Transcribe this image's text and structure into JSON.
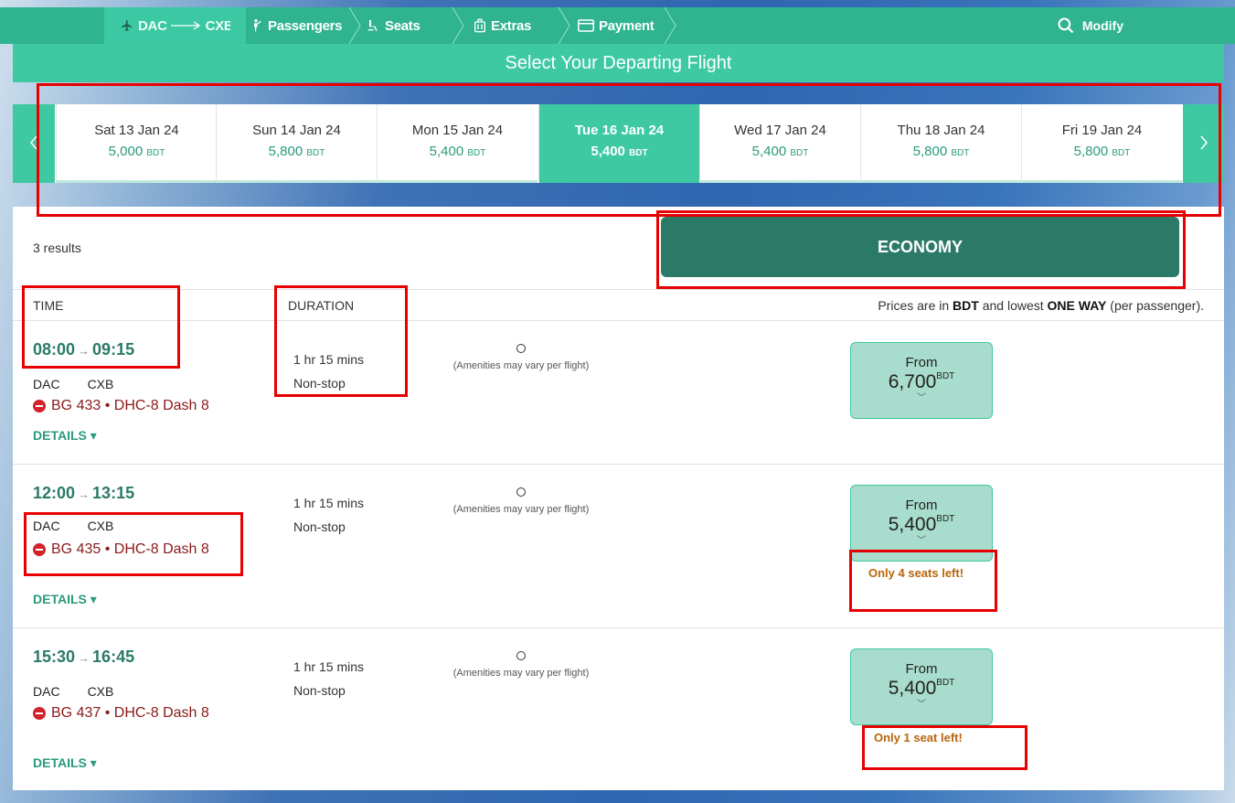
{
  "nav": {
    "steps": [
      {
        "label": "DAC → CXB",
        "origin": "DAC",
        "dest": "CXB",
        "active": true
      },
      {
        "label": "Passengers"
      },
      {
        "label": "Seats"
      },
      {
        "label": "Extras"
      },
      {
        "label": "Payment"
      }
    ],
    "modify_label": "Modify"
  },
  "title": "Select Your Departing Flight",
  "dates": [
    {
      "date": "Sat 13 Jan 24",
      "price": "5,000",
      "currency": "BDT"
    },
    {
      "date": "Sun 14 Jan 24",
      "price": "5,800",
      "currency": "BDT"
    },
    {
      "date": "Mon 15 Jan 24",
      "price": "5,400",
      "currency": "BDT"
    },
    {
      "date": "Tue 16 Jan 24",
      "price": "5,400",
      "currency": "BDT",
      "selected": true
    },
    {
      "date": "Wed 17 Jan 24",
      "price": "5,400",
      "currency": "BDT"
    },
    {
      "date": "Thu 18 Jan 24",
      "price": "5,800",
      "currency": "BDT"
    },
    {
      "date": "Fri 19 Jan 24",
      "price": "5,800",
      "currency": "BDT"
    }
  ],
  "results": {
    "count_label": "3 results",
    "cabin_label": "ECONOMY",
    "col_time": "TIME",
    "col_duration": "DURATION",
    "note_prefix": "Prices are in ",
    "note_currency": "BDT",
    "note_mid": " and lowest ",
    "note_oneway": "ONE WAY",
    "note_suffix": " (per passenger)."
  },
  "flights": [
    {
      "dep": "08:00",
      "arr": "09:15",
      "origin": "DAC",
      "dest": "CXB",
      "flight_no": "BG 433",
      "aircraft": "DHC-8 Dash 8",
      "duration": "1 hr 15 mins",
      "stops": "Non-stop",
      "amenities_note": "(Amenities may vary per flight)",
      "from_label": "From",
      "price": "6,700",
      "currency": "BDT",
      "seats_left": "",
      "details_label": "DETAILS ▾"
    },
    {
      "dep": "12:00",
      "arr": "13:15",
      "origin": "DAC",
      "dest": "CXB",
      "flight_no": "BG 435",
      "aircraft": "DHC-8 Dash 8",
      "duration": "1 hr 15 mins",
      "stops": "Non-stop",
      "amenities_note": "(Amenities may vary per flight)",
      "from_label": "From",
      "price": "5,400",
      "currency": "BDT",
      "seats_left": "Only 4 seats left!",
      "details_label": "DETAILS ▾"
    },
    {
      "dep": "15:30",
      "arr": "16:45",
      "origin": "DAC",
      "dest": "CXB",
      "flight_no": "BG 437",
      "aircraft": "DHC-8 Dash 8",
      "duration": "1 hr 15 mins",
      "stops": "Non-stop",
      "amenities_note": "(Amenities may vary per flight)",
      "from_label": "From",
      "price": "5,400",
      "currency": "BDT",
      "seats_left": "Only 1 seat left!",
      "details_label": "DETAILS ▾"
    }
  ],
  "colors": {
    "primary": "#3ec9a3",
    "nav": "#2fb48f",
    "economy": "#2a7a67",
    "annotation": "#e60000"
  }
}
